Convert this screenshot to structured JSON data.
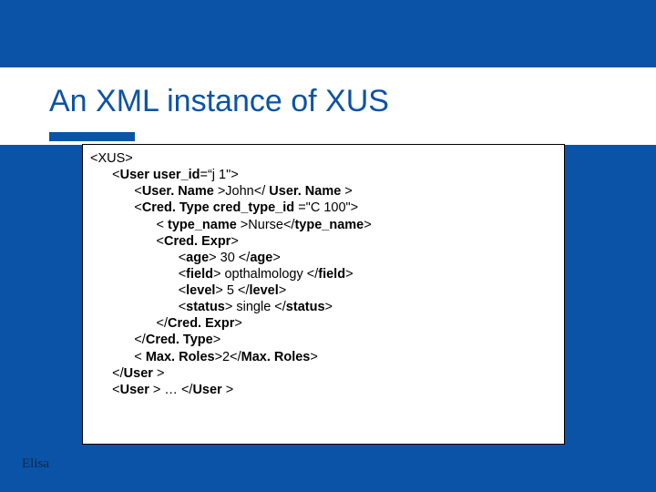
{
  "title": "An XML instance of XUS",
  "code_lines": [
    {
      "indent": 0,
      "segs": [
        {
          "t": "<XUS>",
          "b": false
        }
      ]
    },
    {
      "indent": 1,
      "segs": [
        {
          "t": "<",
          "b": false
        },
        {
          "t": "User",
          "b": true
        },
        {
          "t": " ",
          "b": false
        },
        {
          "t": "user_id",
          "b": true
        },
        {
          "t": "=“j 1\">",
          "b": false
        }
      ]
    },
    {
      "indent": 2,
      "segs": [
        {
          "t": "<",
          "b": false
        },
        {
          "t": "User. Name",
          "b": true
        },
        {
          "t": " >John</ ",
          "b": false
        },
        {
          "t": "User. Name",
          "b": true
        },
        {
          "t": " >",
          "b": false
        }
      ]
    },
    {
      "indent": 2,
      "segs": [
        {
          "t": "<",
          "b": false
        },
        {
          "t": "Cred. Type",
          "b": true
        },
        {
          "t": " ",
          "b": false
        },
        {
          "t": "cred_type_id",
          "b": true
        },
        {
          "t": " =\"C 100\">",
          "b": false
        }
      ]
    },
    {
      "indent": 3,
      "segs": [
        {
          "t": "< ",
          "b": false
        },
        {
          "t": "type_name",
          "b": true
        },
        {
          "t": " >Nurse</",
          "b": false
        },
        {
          "t": "type_name",
          "b": true
        },
        {
          "t": ">",
          "b": false
        }
      ]
    },
    {
      "indent": 3,
      "segs": [
        {
          "t": "<",
          "b": false
        },
        {
          "t": "Cred. Expr",
          "b": true
        },
        {
          "t": ">",
          "b": false
        }
      ]
    },
    {
      "indent": 4,
      "segs": [
        {
          "t": "<",
          "b": false
        },
        {
          "t": "age",
          "b": true
        },
        {
          "t": "> 30 </",
          "b": false
        },
        {
          "t": "age",
          "b": true
        },
        {
          "t": ">",
          "b": false
        }
      ]
    },
    {
      "indent": 4,
      "segs": [
        {
          "t": "<",
          "b": false
        },
        {
          "t": "field",
          "b": true
        },
        {
          "t": "> opthalmology </",
          "b": false
        },
        {
          "t": "field",
          "b": true
        },
        {
          "t": ">",
          "b": false
        }
      ]
    },
    {
      "indent": 4,
      "segs": [
        {
          "t": "<",
          "b": false
        },
        {
          "t": "level",
          "b": true
        },
        {
          "t": "> 5 </",
          "b": false
        },
        {
          "t": "level",
          "b": true
        },
        {
          "t": ">",
          "b": false
        }
      ]
    },
    {
      "indent": 4,
      "segs": [
        {
          "t": "<",
          "b": false
        },
        {
          "t": "status",
          "b": true
        },
        {
          "t": "> single </",
          "b": false
        },
        {
          "t": "status",
          "b": true
        },
        {
          "t": ">",
          "b": false
        }
      ]
    },
    {
      "indent": 3,
      "segs": [
        {
          "t": "</",
          "b": false
        },
        {
          "t": "Cred. Expr",
          "b": true
        },
        {
          "t": ">",
          "b": false
        }
      ]
    },
    {
      "indent": 2,
      "segs": [
        {
          "t": "</",
          "b": false
        },
        {
          "t": "Cred. Type",
          "b": true
        },
        {
          "t": ">",
          "b": false
        }
      ]
    },
    {
      "indent": 2,
      "segs": [
        {
          "t": "< ",
          "b": false
        },
        {
          "t": "Max. Roles",
          "b": true
        },
        {
          "t": ">2</",
          "b": false
        },
        {
          "t": "Max. Roles",
          "b": true
        },
        {
          "t": ">",
          "b": false
        }
      ]
    },
    {
      "indent": 1,
      "segs": [
        {
          "t": "</",
          "b": false
        },
        {
          "t": "User",
          "b": true
        },
        {
          "t": " >",
          "b": false
        }
      ]
    },
    {
      "indent": 1,
      "segs": [
        {
          "t": "<",
          "b": false
        },
        {
          "t": "User",
          "b": true
        },
        {
          "t": " > … </",
          "b": false
        },
        {
          "t": "User",
          "b": true
        },
        {
          "t": " >",
          "b": false
        }
      ]
    }
  ],
  "footer": {
    "author": "Elisa "
  }
}
